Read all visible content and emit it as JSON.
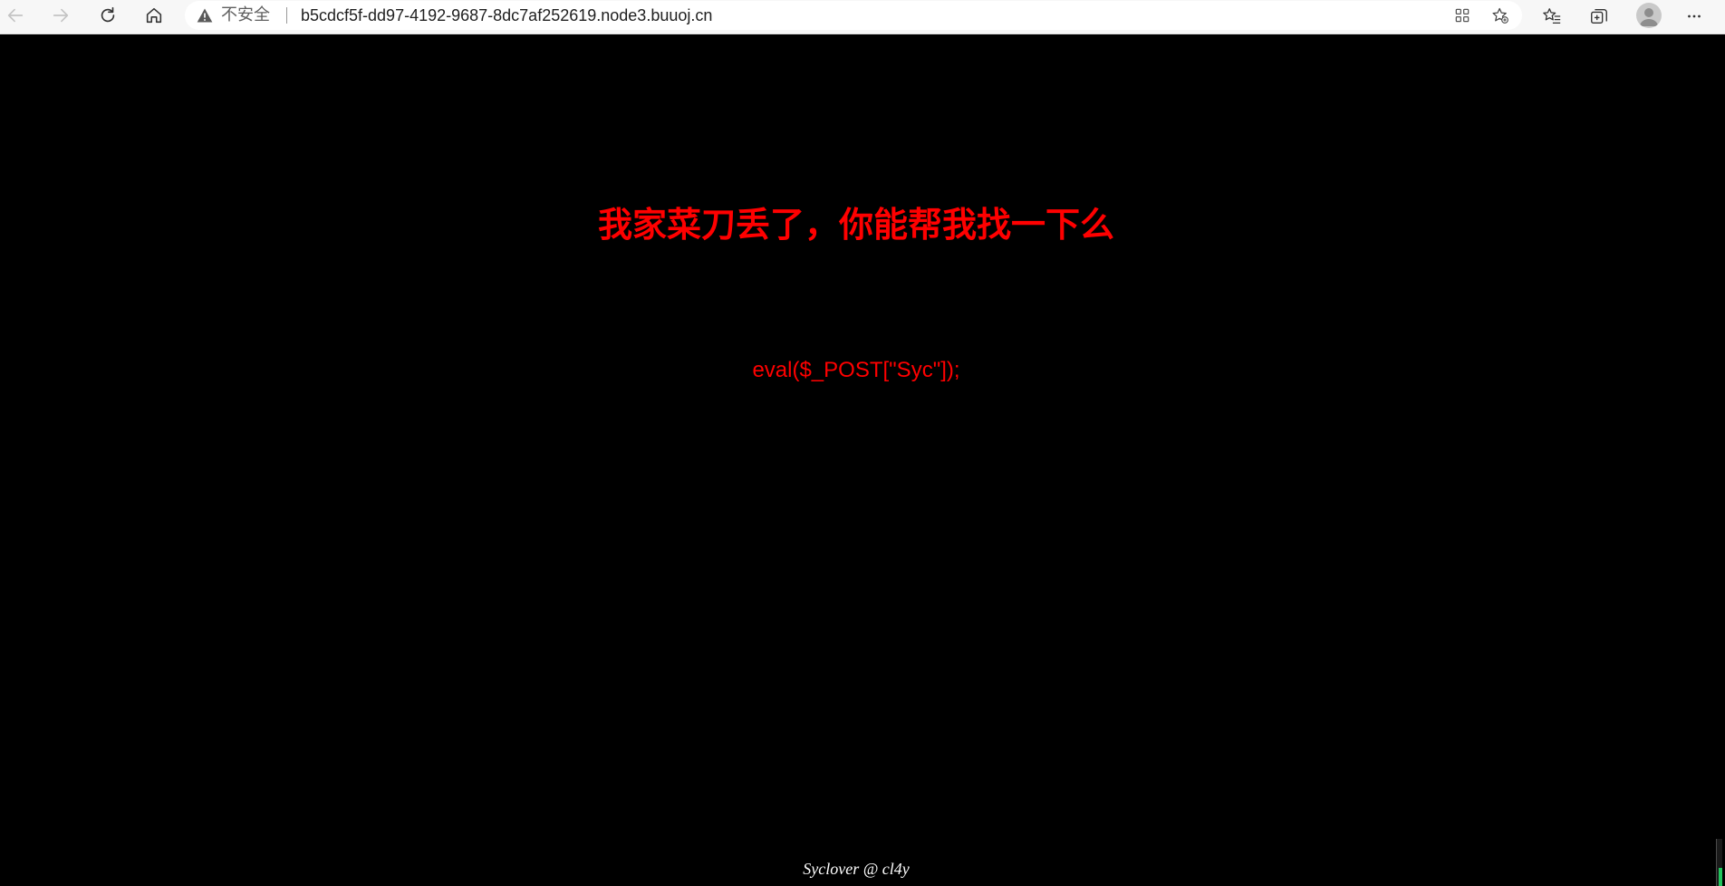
{
  "browser": {
    "security_label": "不安全",
    "url": "b5cdcf5f-dd97-4192-9687-8dc7af252619.node3.buuoj.cn",
    "icons": [
      "back-icon",
      "forward-icon",
      "refresh-icon",
      "home-icon",
      "warning-icon",
      "app-grid-icon",
      "add-favorite-icon",
      "favorites-icon",
      "collections-icon",
      "profile-avatar",
      "more-icon"
    ]
  },
  "page": {
    "headline": "我家菜刀丢了，你能帮我找一下么",
    "code": "eval($_POST[\"Syc\"]);",
    "footer": "Syclover @ cl4y"
  },
  "colors": {
    "background": "#000000",
    "headline": "#ff0000",
    "code": "#ff0000",
    "footer": "#ffffff",
    "chrome": "#f7f7f7"
  }
}
